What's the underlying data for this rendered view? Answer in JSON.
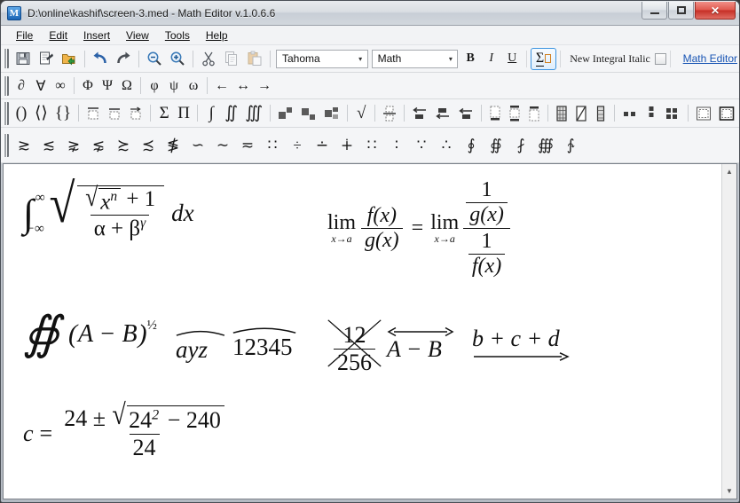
{
  "window": {
    "title": "D:\\online\\kashif\\screen-3.med - Math Editor v.1.0.6.6",
    "app_icon_letter": "M",
    "controls": {
      "minimize": "minimize-button",
      "maximize": "maximize-button",
      "close": "✕"
    },
    "accent_close": "#c62f26",
    "accent_link": "#1955b4",
    "accent_active_border": "#3d94e0"
  },
  "menu": {
    "items": [
      {
        "label": "File"
      },
      {
        "label": "Edit"
      },
      {
        "label": "Insert"
      },
      {
        "label": "View"
      },
      {
        "label": "Tools"
      },
      {
        "label": "Help"
      }
    ]
  },
  "toolbar_main": {
    "buttons": [
      {
        "name": "save-icon",
        "glyph": "Ὃe"
      },
      {
        "name": "open-document-icon",
        "glyph": ""
      },
      {
        "name": "open-folder-icon",
        "glyph": ""
      },
      {
        "name": "undo-icon",
        "glyph": "↶"
      },
      {
        "name": "redo-icon",
        "glyph": "↷"
      },
      {
        "name": "zoom-out-icon",
        "glyph": "−"
      },
      {
        "name": "zoom-in-icon",
        "glyph": "+"
      },
      {
        "name": "cut-icon",
        "glyph": "✂"
      },
      {
        "name": "copy-icon",
        "glyph": ""
      },
      {
        "name": "paste-icon",
        "glyph": ""
      }
    ],
    "font_combo": {
      "value": "Tahoma",
      "arrow": "▾"
    },
    "style_combo": {
      "value": "Math",
      "arrow": "▾"
    },
    "bold_label": "B",
    "italic_label": "I",
    "underline_label": "U",
    "sigma_label": "Σ",
    "integral_italic_label": "New Integral Italic",
    "math_editor_link": "Math Editor"
  },
  "symbol_row_1": {
    "groups": [
      [
        "∂",
        "∀",
        "∞"
      ],
      [
        "Φ",
        "Ψ",
        "Ω"
      ],
      [
        "φ",
        "ψ",
        "ω"
      ],
      [
        "←",
        "↔",
        "→"
      ]
    ]
  },
  "symbol_row_2": {
    "brackets": [
      "(",
      ")",
      "⟨",
      "⟩",
      "{",
      "}"
    ],
    "bigops": [
      "Σ",
      "Π"
    ],
    "integrals": [
      "∫",
      "∬",
      "∭"
    ],
    "radical": "√"
  },
  "symbol_row_3": {
    "symbols": [
      "≳",
      "≲",
      "⋧",
      "⋦",
      "≿",
      "≾",
      "≸",
      "∽",
      "∼",
      "≂",
      "∷",
      "÷",
      "∸",
      "∔",
      "∷",
      "∶",
      "∵",
      "∴",
      "∮",
      "∯",
      "⨏",
      "∰",
      "∱"
    ]
  },
  "document": {
    "equations": [
      {
        "name": "integral-equation",
        "latex": "\\int_{-\\infty}^{\\infty} \\sqrt{\\frac{\\sqrt{x^n}+1}{\\alpha+\\beta^{\\gamma}}}\\,dx",
        "parts": {
          "integral": "∫",
          "upper_limit": "∞",
          "lower_limit": "−∞",
          "inner_radicand_var": "x",
          "inner_exponent": "n",
          "numerator_tail": "+ 1",
          "denominator": "α + β",
          "denominator_exponent": "γ",
          "differential": "dx"
        }
      },
      {
        "name": "limit-equation",
        "latex": "\\lim_{x\\to a}\\frac{f(x)}{g(x)}=\\lim_{x\\to a}\\frac{\\frac{1}{g(x)}}{\\frac{1}{f(x)}}",
        "parts": {
          "lim": "lim",
          "subscript": "x→a",
          "numerator": "f(x)",
          "denominator": "g(x)",
          "equals": "=",
          "one": "1"
        }
      },
      {
        "name": "surface-integral-equation",
        "latex": "\\oiint (A-B)^{1/2}",
        "parts": {
          "operator": "∯",
          "open": "(",
          "body": "A − B",
          "close": ")",
          "exponent": "½"
        }
      },
      {
        "name": "widehat-ayz",
        "latex": "\\widehat{ayz}",
        "parts": {
          "body": "ayz"
        }
      },
      {
        "name": "widehat-12345",
        "latex": "\\widehat{12345}",
        "parts": {
          "body": "12345"
        }
      },
      {
        "name": "cancelled-fraction",
        "latex": "\\cancel{\\frac{12}{256}}",
        "parts": {
          "numerator": "12",
          "denominator": "256"
        }
      },
      {
        "name": "overleftrightarrow-ab",
        "latex": "\\overleftrightarrow{A-B}",
        "parts": {
          "body": "A − B"
        }
      },
      {
        "name": "underrightarrow-bcd",
        "latex": "\\underrightarrow{b+c+d}",
        "parts": {
          "body": "b + c + d"
        }
      },
      {
        "name": "quadratic-equation",
        "latex": "c=\\frac{24\\pm\\sqrt{24^2-240}}{24}",
        "parts": {
          "lhs": "c",
          "equals": "=",
          "numerator_lead": "24 ±",
          "radicand_base": "24",
          "radicand_exponent": "2",
          "radicand_tail": "− 240",
          "denominator": "24"
        }
      }
    ]
  },
  "scrollbar": {
    "up_arrow": "▲",
    "down_arrow": "▼"
  }
}
